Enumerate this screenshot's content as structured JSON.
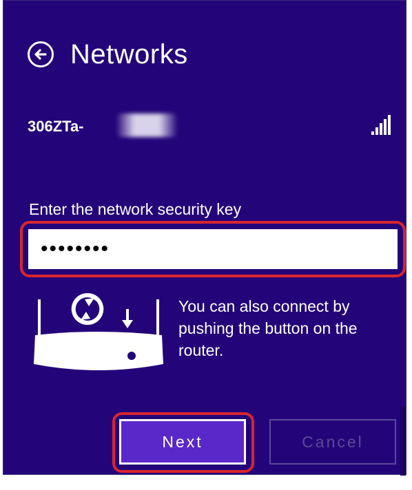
{
  "header": {
    "title": "Networks",
    "back_icon": "arrow-left-circle-icon"
  },
  "network": {
    "name": "306ZTa-",
    "signal_icon": "signal-strength-icon"
  },
  "security": {
    "label": "Enter the network security key",
    "value": "••••••••",
    "highlight_color": "#d8262e"
  },
  "wps": {
    "icon": "router-wps-icon",
    "text": "You can also connect by pushing the button on the router."
  },
  "actions": {
    "next_label": "Next",
    "cancel_label": "Cancel"
  },
  "colors": {
    "background": "#240579",
    "accent_button": "#5a28c8",
    "highlight": "#d8262e"
  }
}
